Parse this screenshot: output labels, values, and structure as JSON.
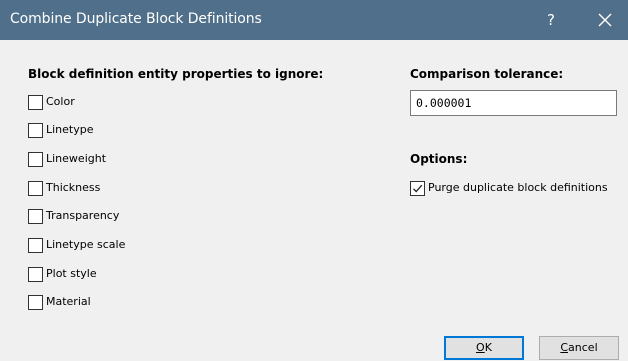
{
  "window": {
    "title": "Combine Duplicate Block Definitions",
    "help_label": "?"
  },
  "ignore_section": {
    "heading": "Block definition entity properties to ignore:",
    "items": [
      {
        "label": "Color",
        "checked": false
      },
      {
        "label": "Linetype",
        "checked": false
      },
      {
        "label": "Lineweight",
        "checked": false
      },
      {
        "label": "Thickness",
        "checked": false
      },
      {
        "label": "Transparency",
        "checked": false
      },
      {
        "label": "Linetype scale",
        "checked": false
      },
      {
        "label": "Plot style",
        "checked": false
      },
      {
        "label": "Material",
        "checked": false
      }
    ]
  },
  "tolerance": {
    "heading": "Comparison tolerance:",
    "value": "0.000001"
  },
  "options": {
    "heading": "Options:",
    "purge": {
      "label": "Purge duplicate block definitions",
      "checked": true
    }
  },
  "buttons": {
    "ok_mnemonic": "O",
    "ok_rest": "K",
    "cancel_mnemonic": "C",
    "cancel_rest": "ancel"
  },
  "colors": {
    "titlebar": "#506f8a",
    "background": "#f0f0f0",
    "default_button_border": "#0078d7"
  }
}
